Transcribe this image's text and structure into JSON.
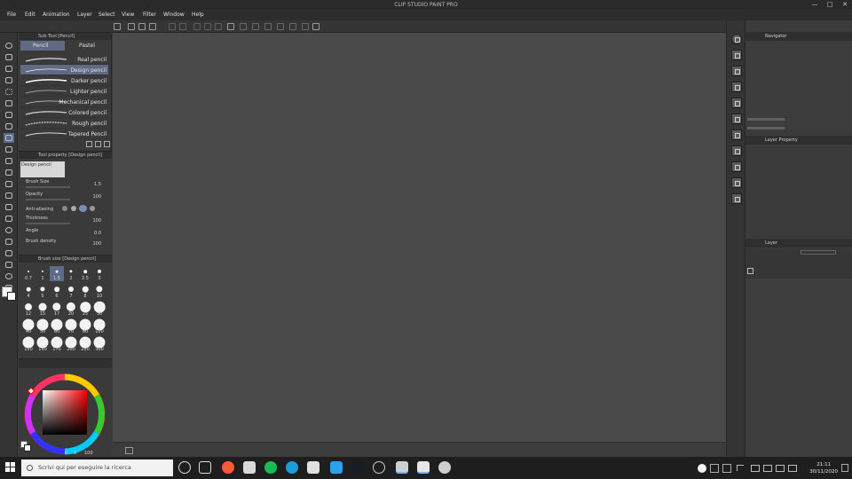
{
  "app": {
    "title": "CLIP STUDIO PAINT PRO"
  },
  "window_controls": {
    "minimize": "—",
    "maximize": "□",
    "close": "✕"
  },
  "menu": [
    "File",
    "Edit",
    "Animation",
    "Layer",
    "Select",
    "View",
    "Filter",
    "Window",
    "Help"
  ],
  "subtool": {
    "header": "Sub Tool [Pencil]",
    "tabs": [
      {
        "label": "Pencil",
        "selected": true
      },
      {
        "label": "Pastel",
        "selected": false
      }
    ],
    "brushes": [
      {
        "label": "Real pencil",
        "selected": false
      },
      {
        "label": "Design pencil",
        "selected": true
      },
      {
        "label": "Darker pencil",
        "selected": false
      },
      {
        "label": "Lighter pencil",
        "selected": false
      },
      {
        "label": "Mechanical pencil",
        "selected": false
      },
      {
        "label": "Colored pencil",
        "selected": false
      },
      {
        "label": "Rough pencil",
        "selected": false
      },
      {
        "label": "Tapered Pencil",
        "selected": false
      }
    ]
  },
  "tool_property": {
    "header": "Tool property [Design pencil]",
    "preset_name": "Design pencil",
    "brush_size_label": "Brush Size",
    "brush_size_value": "1.5",
    "opacity_label": "Opacity",
    "opacity_value": "100",
    "anti_alias_label": "Anti-aliasing",
    "thickness_label": "Thickness",
    "thickness_value": "100",
    "angle_label": "Angle",
    "angle_value": "0.0",
    "brush_density_label": "Brush density",
    "brush_density_value": "100"
  },
  "brush_size_panel": {
    "header": "Brush size [Design pencil]",
    "sizes": [
      "0.7",
      "1",
      "1.5",
      "2",
      "2.5",
      "3",
      "4",
      "5",
      "6",
      "7",
      "8",
      "10",
      "12",
      "15",
      "17",
      "20",
      "25",
      "30",
      "40",
      "50",
      "60",
      "70",
      "80",
      "100",
      "120",
      "150",
      "170",
      "200",
      "250",
      "300"
    ],
    "selected": "1.5"
  },
  "color_panel": {
    "value_a": "0",
    "value_b": "0",
    "value_c": "100"
  },
  "navigator": {
    "header": "Navigator"
  },
  "layer_property": {
    "header": "Layer Property"
  },
  "layer": {
    "header": "Layer"
  },
  "taskbar": {
    "search_placeholder": "Scrivi qui per eseguire la ricerca",
    "time": "21:11",
    "date": "30/11/2020",
    "colors": {
      "accent": "#7fb0e6",
      "chrome": "#ff5a36",
      "spotify": "#1db954",
      "edge": "#1f9bd8"
    }
  }
}
